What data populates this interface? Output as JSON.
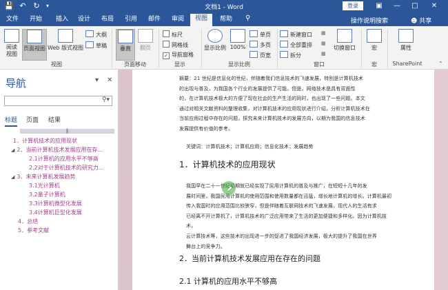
{
  "window": {
    "title": "文档1 - Word",
    "login": "登录",
    "share": "共享",
    "tell_me": "操作说明搜索"
  },
  "tabs": [
    "文件",
    "开始",
    "插入",
    "设计",
    "布局",
    "引用",
    "邮件",
    "审阅",
    "视图",
    "帮助"
  ],
  "ribbon": {
    "views": {
      "read": "阅读视图",
      "print": "页面视图",
      "web": "Web 版式视图",
      "outline": "大纲",
      "draft": "草稿",
      "label": "视图"
    },
    "page_move": {
      "vertical": "垂直",
      "side": "翻页",
      "label": "页面移动"
    },
    "show": {
      "ruler": "标尺",
      "grid": "网格线",
      "nav": "导航窗格",
      "label": "显示"
    },
    "zoom": {
      "zoom": "显示比例",
      "hundred": "100%",
      "one_page": "单页",
      "multi_page": "多页",
      "page_width": "页宽",
      "label": "显示比例"
    },
    "window": {
      "new": "新建窗口",
      "arrange": "全部重排",
      "split": "拆分",
      "switch": "切换窗口",
      "label": "窗口"
    },
    "macro": {
      "macro": "宏",
      "label": "宏"
    },
    "sharepoint": {
      "props": "属性",
      "label": "SharePoint"
    }
  },
  "nav": {
    "title": "导航",
    "search_placeholder": "",
    "tabs": [
      "标题",
      "页面",
      "结果"
    ],
    "items": [
      "1．计算机技术的应用现状",
      "2．当前计算机技术发展应用在存...",
      "2.1计算机的应用水平不够高",
      "2.2对于计算机技术的研究力...",
      "3．未来计算机发展趋势",
      "3.1光计算机",
      "3.2量子计算机",
      "3.3计算机微型化发展",
      "3.4计算机巨型化发展",
      "4．总结",
      "5．参考文献"
    ]
  },
  "doc": {
    "abstract_lines": [
      "摘要：21 世纪是信息化的世纪，伴随着我们信息技术的飞速发展，特别是计算机技术",
      "的出现与普及，为我国各个行业的发展提供了可能。但是，网络技术是具有双面性",
      "的，在计算机技术极大的方便了现在社会的生产生活的同时，也出现了一些问题。本文",
      "通过对相关文献资料的整理收集，对计算机技术的应用现状进行介绍，分析计算机技术在",
      "当前应用过程中存在的问题，探究未来计算机技术的发展方向，以期为我国的信息技术",
      "发展提供有价值的参考。"
    ],
    "keywords": "关键词：计算机技术；计算机应用；信息化技术；发展趋势",
    "h1": "1．计算机技术的应用现状",
    "body_lines": [
      "我国早在二十一世纪初期就已经实现了民用计算机的普及与推广，在短短十几年的发",
      "展时间里，我国民用计算机的使用范围和使用数量都在迅猛，增长地计算机的增长。计算机最初",
      "传入我国时的应用范围比较狭窄，但是伴随着互联网技术的飞速发展，现代人的生活有求",
      "已经离不开计算机了，计算机技术的广泛应用带来了生活的更加便捷和多样化。因为计算机技术，",
      "云计算技术等，这些技术的出现进一步的促进了我国经济发展，极大的提升了我国在世界",
      "舞台上的竞争力。"
    ],
    "h2a": "2．当前计算机技术发展应用在存在的问题",
    "h2b": "2.1 计算机的应用水平不够高"
  }
}
